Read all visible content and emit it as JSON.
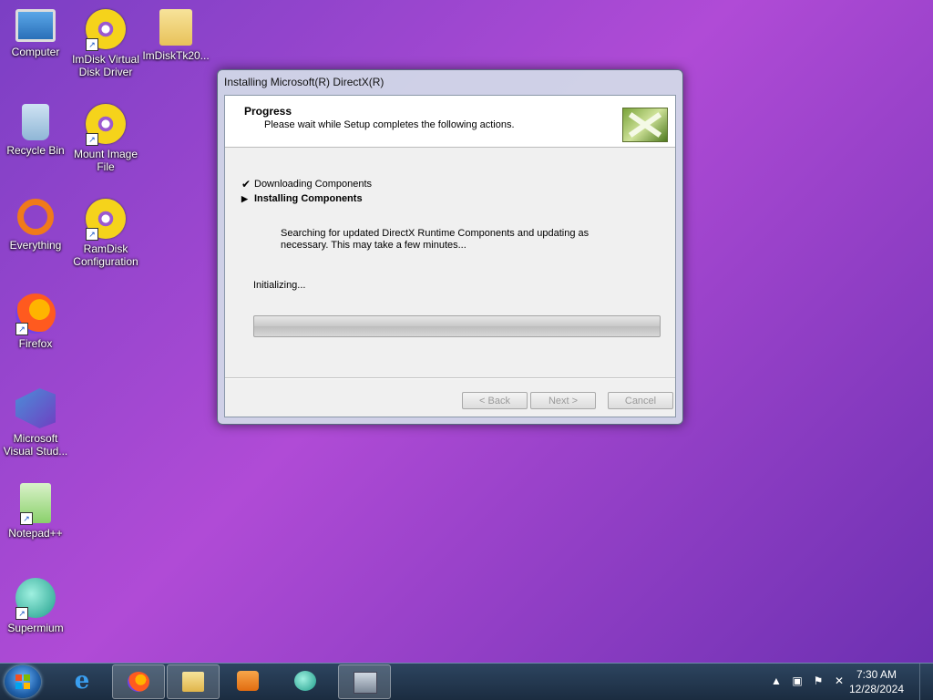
{
  "desktop": {
    "icons": [
      {
        "label": "Computer"
      },
      {
        "label": "ImDisk Virtual Disk Driver"
      },
      {
        "label": "ImDiskTk20..."
      },
      {
        "label": "Recycle Bin"
      },
      {
        "label": "Mount Image File"
      },
      {
        "label": "Everything"
      },
      {
        "label": "RamDisk Configuration"
      },
      {
        "label": "Firefox"
      },
      {
        "label": "Microsoft Visual Stud..."
      },
      {
        "label": "Notepad++"
      },
      {
        "label": "Supermium"
      }
    ]
  },
  "installer": {
    "title": "Installing Microsoft(R) DirectX(R)",
    "header_title": "Progress",
    "header_subtitle": "Please wait while Setup completes the following actions.",
    "steps": [
      {
        "mark": "✔",
        "label": "Downloading Components"
      },
      {
        "mark": "▶",
        "label": "Installing Components"
      }
    ],
    "description": "Searching for updated DirectX Runtime Components and updating as necessary. This may take a few minutes...",
    "status": "Initializing...",
    "progress_fraction": 0,
    "buttons": {
      "back": "< Back",
      "next": "Next >",
      "cancel": "Cancel"
    }
  },
  "taskbar": {
    "clock_time": "7:30 AM",
    "clock_date": "12/28/2024",
    "tray_icons": [
      "show-hidden-icon",
      "network-icon",
      "action-center-flag-icon",
      "volume-muted-icon"
    ]
  }
}
